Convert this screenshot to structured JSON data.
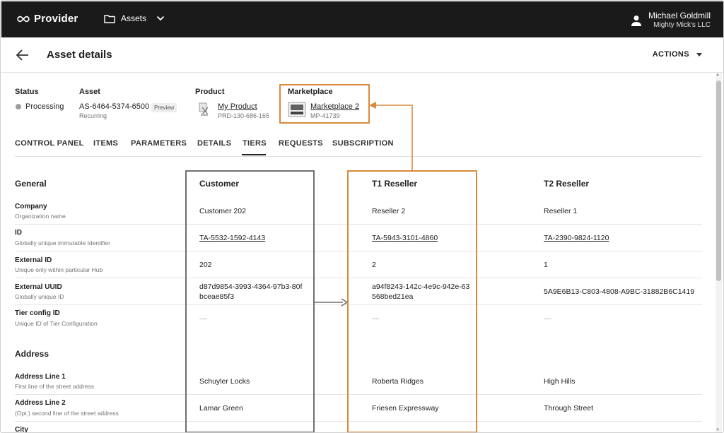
{
  "topbar": {
    "brand": "Provider",
    "module": "Assets",
    "user_name": "Michael Goldmill",
    "user_org": "Mighty Mick's LLC"
  },
  "header": {
    "title": "Asset details",
    "actions_label": "ACTIONS"
  },
  "summary": {
    "status_label": "Status",
    "status_value": "Processing",
    "asset_label": "Asset",
    "asset_id": "AS-6464-5374-6500",
    "asset_badge": "Preview",
    "asset_sub": "Recurring",
    "product_label": "Product",
    "product_name": "My Product",
    "product_id": "PRD-130-686-165",
    "marketplace_label": "Marketplace",
    "marketplace_name": "Marketplace 2",
    "marketplace_id": "MP-41739"
  },
  "tabs": [
    "CONTROL PANEL",
    "ITEMS",
    "PARAMETERS",
    "DETAILS",
    "TIERS",
    "REQUESTS",
    "SUBSCRIPTION"
  ],
  "active_tab": "TIERS",
  "table": {
    "section_general": "General",
    "section_address": "Address",
    "columns": [
      "Customer",
      "T1 Reseller",
      "T2 Reseller"
    ],
    "rows": [
      {
        "label": "Company",
        "sub": "Organization name",
        "values": [
          "Customer 202",
          "Reseller 2",
          "Reseller 1"
        ]
      },
      {
        "label": "ID",
        "sub": "Globally unique immutable Identifier",
        "values": [
          "TA-5532-1592-4143",
          "TA-5943-3101-4860",
          "TA-2390-9824-1120"
        ]
      },
      {
        "label": "External ID",
        "sub": "Unique only within particular Hub",
        "values": [
          "202",
          "2",
          "1"
        ]
      },
      {
        "label": "External UUID",
        "sub": "Globally unique ID",
        "values": [
          "d87d9854-3993-4364-97b3-80fbceae85f3",
          "a94f8243-142c-4e9c-942e-63568bed21ea",
          "5A9E6B13-C803-4808-A9BC-31882B6C1419"
        ]
      },
      {
        "label": "Tier config ID",
        "sub": "Unique ID of Tier Configuration",
        "values": [
          "—",
          "—",
          "—"
        ]
      }
    ],
    "address_rows": [
      {
        "label": "Address Line 1",
        "sub": "First line of the street address",
        "values": [
          "Schuyler Locks",
          "Roberta Ridges",
          "High Hills"
        ]
      },
      {
        "label": "Address Line 2",
        "sub": "(Opt.) second line of the street address",
        "values": [
          "Lamar Green",
          "Friesen Expressway",
          "Through Street"
        ]
      },
      {
        "label": "City",
        "sub": "",
        "values": [
          "",
          "",
          ""
        ]
      }
    ]
  },
  "colors": {
    "topbar": "#1a1a1a",
    "highlight_orange": "#d9893b",
    "highlight_gray": "#6f6f6f"
  }
}
